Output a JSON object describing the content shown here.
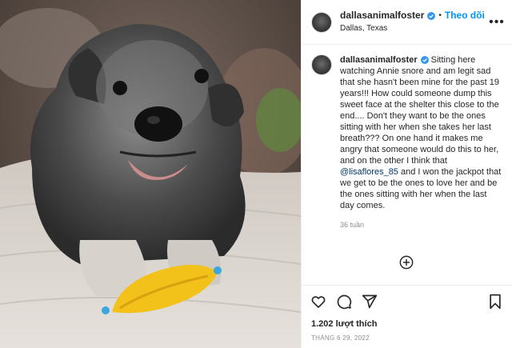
{
  "post": {
    "author": {
      "username": "dallasanimalfoster",
      "location": "Dallas, Texas",
      "follow_label": "Theo dõi",
      "separator": "•",
      "more_label": "•••"
    },
    "caption": {
      "username": "dallasanimalfoster",
      "text_before": " Sitting here watching Annie snore and am legit sad that she hasn't been mine for the past 19 years!!! How could someone dump this sweet face at the shelter this close to the end.... Don't they want to be the ones sitting with her when she takes her last breath??? On one hand it makes me angry that someone would do this to her, and on the other I think that ",
      "mention": "@lisaflores_85",
      "text_after": " and I won the jackpot that we get to be the ones to love her and be the ones sitting with her when the last day comes.",
      "time": "36 tuần"
    },
    "likes": "1.202 lượt thích",
    "date": "THÁNG 6 29, 2022"
  },
  "colors": {
    "accent": "#0095f6",
    "verified": "#3897f0",
    "mention": "#00376b",
    "muted": "#8e8e8e"
  },
  "icons": [
    "more-icon",
    "verified-icon",
    "load-more-icon",
    "heart-icon",
    "comment-icon",
    "share-icon",
    "bookmark-icon"
  ]
}
